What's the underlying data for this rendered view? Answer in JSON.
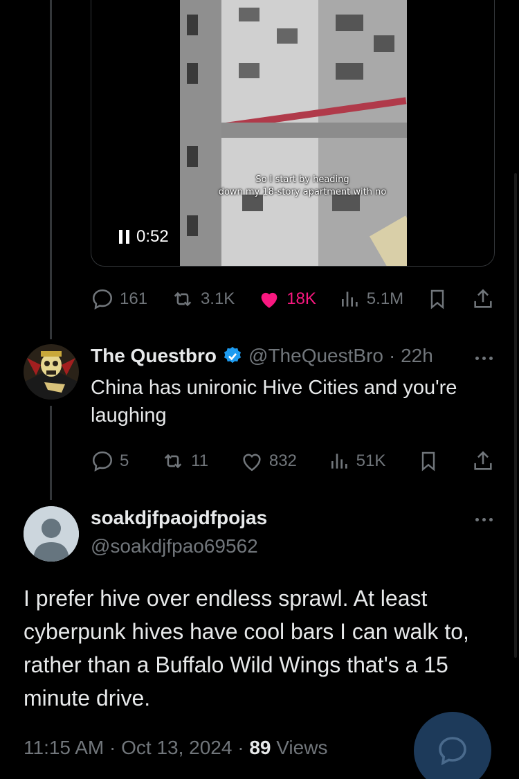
{
  "video": {
    "caption_line1": "So I start by heading",
    "caption_line2": "down my 18-story apartment with no",
    "time": "0:52"
  },
  "tweet1_stats": {
    "replies": "161",
    "reposts": "3.1K",
    "likes": "18K",
    "views": "5.1M"
  },
  "reply_tweet": {
    "display_name": "The Questbro",
    "handle": "@TheQuestBro",
    "time": "· 22h",
    "text": "China has unironic Hive Cities and you're laughing",
    "stats": {
      "replies": "5",
      "reposts": "11",
      "likes": "832",
      "views": "51K"
    }
  },
  "main_tweet": {
    "display_name": "soakdjfpaojdfpojas",
    "handle": "@soakdjfpao69562",
    "text": "I prefer hive over endless sprawl.  At least cyberpunk hives have cool bars I can walk to, rather than a Buffalo Wild Wings that's a 15 minute drive.",
    "timestamp": "11:15 AM · Oct 13, 2024 · ",
    "views_count": "89",
    "views_label": " Views"
  },
  "colors": {
    "accent": "#1d9bf0",
    "like": "#f91880",
    "muted": "#71767b",
    "fab": "#1d3a5a"
  },
  "icons": [
    "pause-icon",
    "reply-icon",
    "repost-icon",
    "like-icon",
    "views-icon",
    "bookmark-icon",
    "share-icon",
    "verified-badge-icon",
    "more-icon",
    "compose-reply-icon"
  ]
}
